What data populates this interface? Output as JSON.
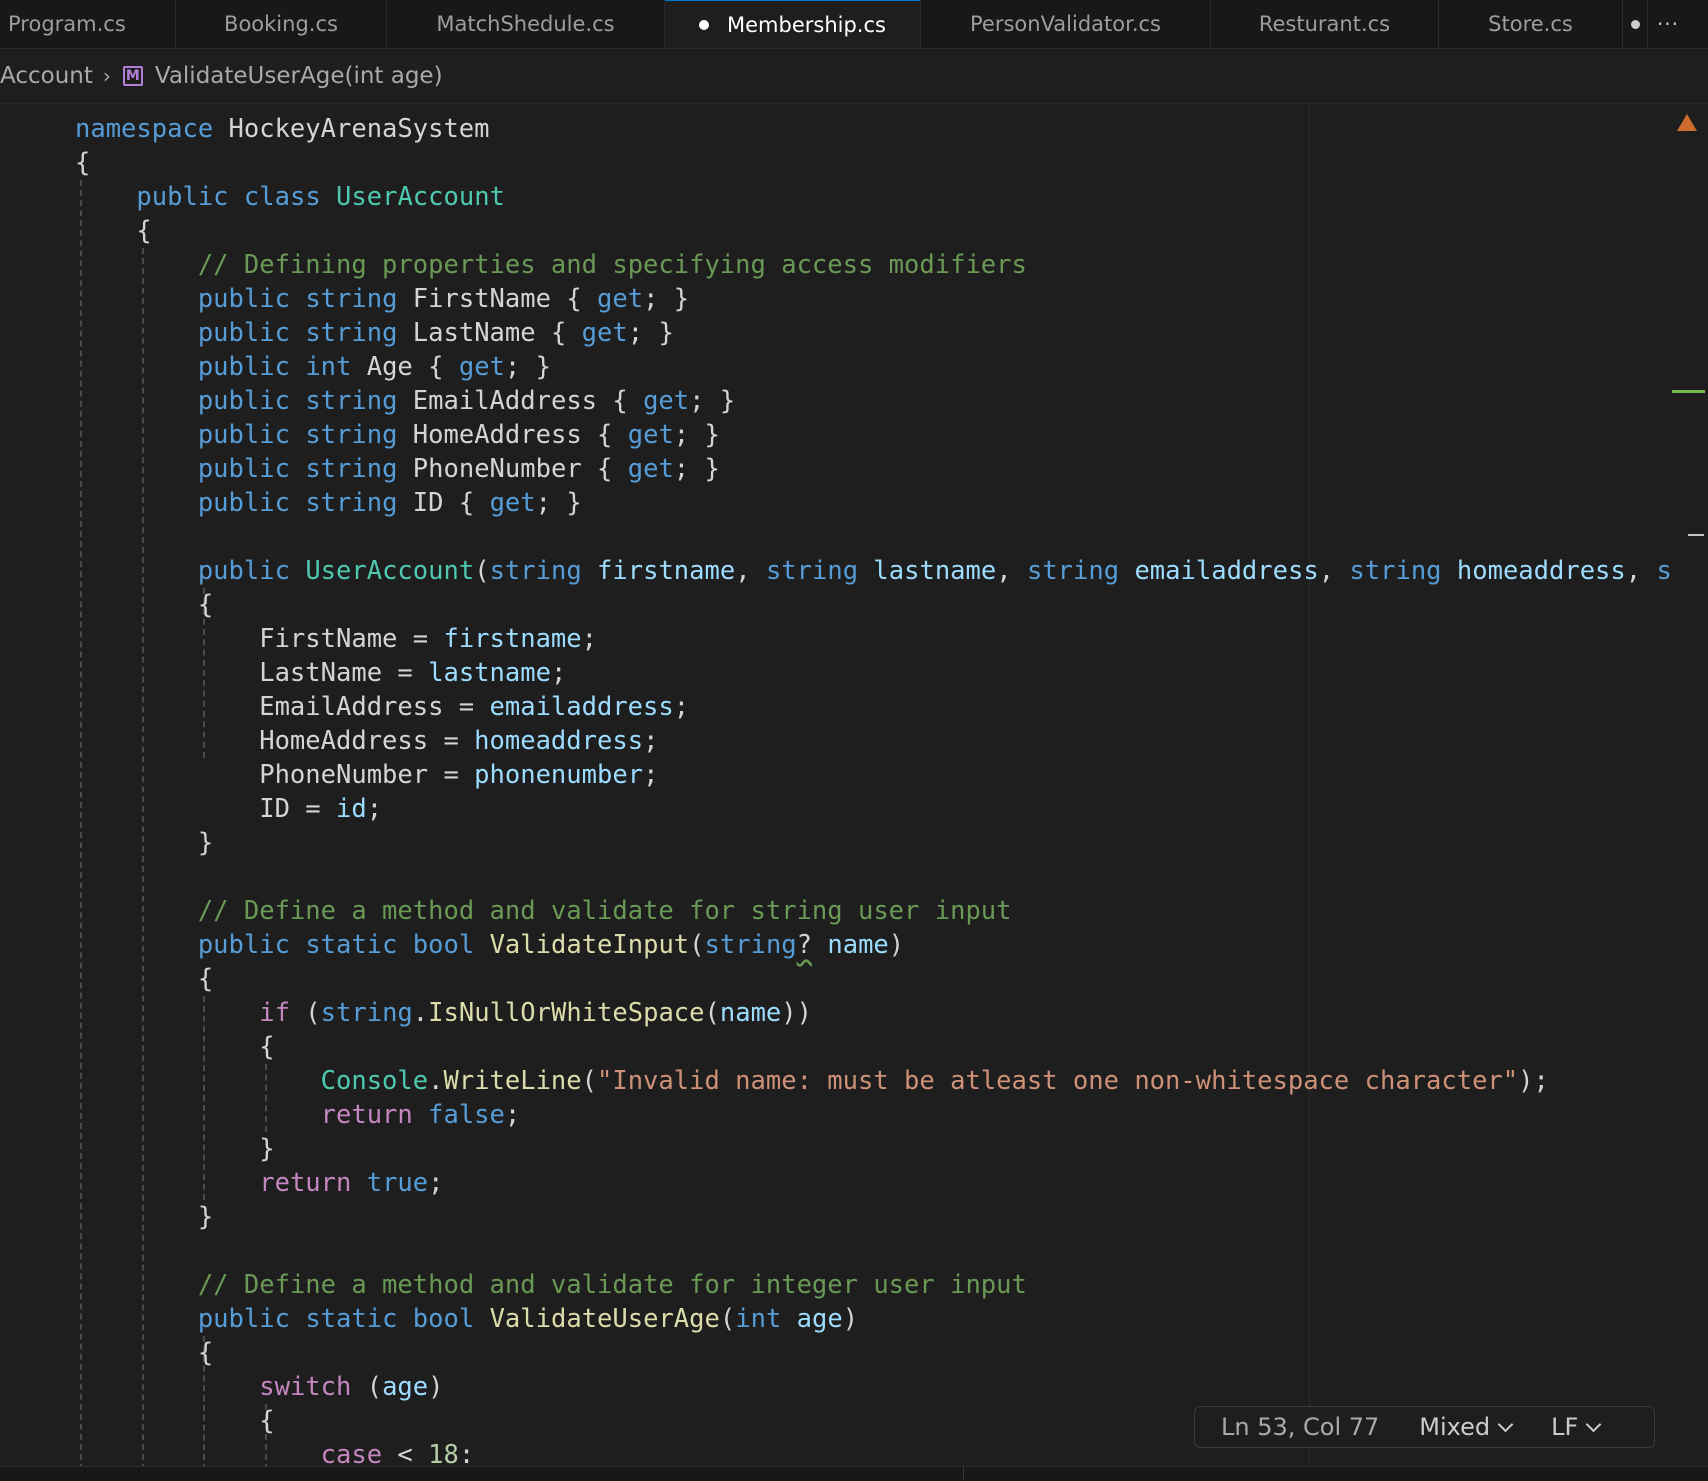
{
  "tabs": [
    {
      "label": "Program.cs",
      "active": false
    },
    {
      "label": "Booking.cs",
      "active": false
    },
    {
      "label": "MatchShedule.cs",
      "active": false
    },
    {
      "label": "Membership.cs",
      "active": true,
      "modified": true
    },
    {
      "label": "PersonValidator.cs",
      "active": false
    },
    {
      "label": "Resturant.cs",
      "active": false
    },
    {
      "label": "Store.cs",
      "active": false
    }
  ],
  "tab_more_label": "···",
  "breadcrumb": {
    "parent": "Account",
    "method": "ValidateUserAge(int age)",
    "method_icon": "method-icon"
  },
  "status": {
    "position": "Ln 53, Col 77",
    "indentation": "Mixed",
    "line_ending": "LF"
  },
  "colors": {
    "keyword": "#569cd6",
    "control": "#c586c0",
    "type": "#4ec9b0",
    "function": "#dcdcaa",
    "variable": "#9cdcfe",
    "comment": "#6a9955",
    "string": "#ce9178",
    "number": "#b5cea8",
    "warning": "#cc6d2e"
  },
  "code": {
    "lines": [
      [
        [
          "kw",
          "namespace"
        ],
        [
          "pun",
          " HockeyArenaSystem"
        ]
      ],
      [
        [
          "pun",
          "{"
        ]
      ],
      [
        [
          "pun",
          "    "
        ],
        [
          "kw",
          "public"
        ],
        [
          "pun",
          " "
        ],
        [
          "kw",
          "class"
        ],
        [
          "pun",
          " "
        ],
        [
          "typ",
          "UserAccount"
        ]
      ],
      [
        [
          "pun",
          "    {"
        ]
      ],
      [
        [
          "pun",
          "        "
        ],
        [
          "cmt",
          "// Defining properties and specifying access modifiers"
        ]
      ],
      [
        [
          "pun",
          "        "
        ],
        [
          "kw",
          "public"
        ],
        [
          "pun",
          " "
        ],
        [
          "kw",
          "string"
        ],
        [
          "pun",
          " FirstName { "
        ],
        [
          "kw",
          "get"
        ],
        [
          "pun",
          "; }"
        ]
      ],
      [
        [
          "pun",
          "        "
        ],
        [
          "kw",
          "public"
        ],
        [
          "pun",
          " "
        ],
        [
          "kw",
          "string"
        ],
        [
          "pun",
          " LastName { "
        ],
        [
          "kw",
          "get"
        ],
        [
          "pun",
          "; }"
        ]
      ],
      [
        [
          "pun",
          "        "
        ],
        [
          "kw",
          "public"
        ],
        [
          "pun",
          " "
        ],
        [
          "kw",
          "int"
        ],
        [
          "pun",
          " Age { "
        ],
        [
          "kw",
          "get"
        ],
        [
          "pun",
          "; }"
        ]
      ],
      [
        [
          "pun",
          "        "
        ],
        [
          "kw",
          "public"
        ],
        [
          "pun",
          " "
        ],
        [
          "kw",
          "string"
        ],
        [
          "pun",
          " EmailAddress { "
        ],
        [
          "kw",
          "get"
        ],
        [
          "pun",
          "; }"
        ]
      ],
      [
        [
          "pun",
          "        "
        ],
        [
          "kw",
          "public"
        ],
        [
          "pun",
          " "
        ],
        [
          "kw",
          "string"
        ],
        [
          "pun",
          " HomeAddress { "
        ],
        [
          "kw",
          "get"
        ],
        [
          "pun",
          "; }"
        ]
      ],
      [
        [
          "pun",
          "        "
        ],
        [
          "kw",
          "public"
        ],
        [
          "pun",
          " "
        ],
        [
          "kw",
          "string"
        ],
        [
          "pun",
          " PhoneNumber { "
        ],
        [
          "kw",
          "get"
        ],
        [
          "pun",
          "; }"
        ]
      ],
      [
        [
          "pun",
          "        "
        ],
        [
          "kw",
          "public"
        ],
        [
          "pun",
          " "
        ],
        [
          "kw",
          "string"
        ],
        [
          "pun",
          " ID { "
        ],
        [
          "kw",
          "get"
        ],
        [
          "pun",
          "; }"
        ]
      ],
      [],
      [
        [
          "pun",
          "        "
        ],
        [
          "kw",
          "public"
        ],
        [
          "pun",
          " "
        ],
        [
          "typ",
          "UserAccount"
        ],
        [
          "pun",
          "("
        ],
        [
          "kw",
          "string"
        ],
        [
          "pun",
          " "
        ],
        [
          "var",
          "firstname"
        ],
        [
          "pun",
          ", "
        ],
        [
          "kw",
          "string"
        ],
        [
          "pun",
          " "
        ],
        [
          "var",
          "lastname"
        ],
        [
          "pun",
          ", "
        ],
        [
          "kw",
          "string"
        ],
        [
          "pun",
          " "
        ],
        [
          "var",
          "emailaddress"
        ],
        [
          "pun",
          ", "
        ],
        [
          "kw",
          "string"
        ],
        [
          "pun",
          " "
        ],
        [
          "var",
          "homeaddress"
        ],
        [
          "pun",
          ", "
        ],
        [
          "kw",
          "s"
        ]
      ],
      [
        [
          "pun",
          "        {"
        ]
      ],
      [
        [
          "pun",
          "            FirstName = "
        ],
        [
          "var",
          "firstname"
        ],
        [
          "pun",
          ";"
        ]
      ],
      [
        [
          "pun",
          "            LastName = "
        ],
        [
          "var",
          "lastname"
        ],
        [
          "pun",
          ";"
        ]
      ],
      [
        [
          "pun",
          "            EmailAddress = "
        ],
        [
          "var",
          "emailaddress"
        ],
        [
          "pun",
          ";"
        ]
      ],
      [
        [
          "pun",
          "            HomeAddress = "
        ],
        [
          "var",
          "homeaddress"
        ],
        [
          "pun",
          ";"
        ]
      ],
      [
        [
          "pun",
          "            PhoneNumber = "
        ],
        [
          "var",
          "phonenumber"
        ],
        [
          "pun",
          ";"
        ]
      ],
      [
        [
          "pun",
          "            ID = "
        ],
        [
          "var",
          "id"
        ],
        [
          "pun",
          ";"
        ]
      ],
      [
        [
          "pun",
          "        }"
        ]
      ],
      [],
      [
        [
          "pun",
          "        "
        ],
        [
          "cmt",
          "// Define a method and validate for string user input"
        ]
      ],
      [
        [
          "pun",
          "        "
        ],
        [
          "kw",
          "public"
        ],
        [
          "pun",
          " "
        ],
        [
          "kw",
          "static"
        ],
        [
          "pun",
          " "
        ],
        [
          "kw",
          "bool"
        ],
        [
          "pun",
          " "
        ],
        [
          "fn",
          "ValidateInput"
        ],
        [
          "pun",
          "("
        ],
        [
          "kw",
          "string"
        ],
        [
          "sq",
          "?"
        ],
        [
          "pun",
          " "
        ],
        [
          "var",
          "name"
        ],
        [
          "pun",
          ")"
        ]
      ],
      [
        [
          "pun",
          "        {"
        ]
      ],
      [
        [
          "pun",
          "            "
        ],
        [
          "ctl",
          "if"
        ],
        [
          "pun",
          " ("
        ],
        [
          "kw",
          "string"
        ],
        [
          "pun",
          "."
        ],
        [
          "fn",
          "IsNullOrWhiteSpace"
        ],
        [
          "pun",
          "("
        ],
        [
          "var",
          "name"
        ],
        [
          "pun",
          "))"
        ]
      ],
      [
        [
          "pun",
          "            {"
        ]
      ],
      [
        [
          "pun",
          "                "
        ],
        [
          "typ",
          "Console"
        ],
        [
          "pun",
          "."
        ],
        [
          "fn",
          "WriteLine"
        ],
        [
          "pun",
          "("
        ],
        [
          "str",
          "\"Invalid name: must be atleast one non-whitespace character\""
        ],
        [
          "pun",
          ");"
        ]
      ],
      [
        [
          "pun",
          "                "
        ],
        [
          "ctl",
          "return"
        ],
        [
          "pun",
          " "
        ],
        [
          "kw",
          "false"
        ],
        [
          "pun",
          ";"
        ]
      ],
      [
        [
          "pun",
          "            }"
        ]
      ],
      [
        [
          "pun",
          "            "
        ],
        [
          "ctl",
          "return"
        ],
        [
          "pun",
          " "
        ],
        [
          "kw",
          "true"
        ],
        [
          "pun",
          ";"
        ]
      ],
      [
        [
          "pun",
          "        }"
        ]
      ],
      [],
      [
        [
          "pun",
          "        "
        ],
        [
          "cmt",
          "// Define a method and validate for integer user input"
        ]
      ],
      [
        [
          "pun",
          "        "
        ],
        [
          "kw",
          "public"
        ],
        [
          "pun",
          " "
        ],
        [
          "kw",
          "static"
        ],
        [
          "pun",
          " "
        ],
        [
          "kw",
          "bool"
        ],
        [
          "pun",
          " "
        ],
        [
          "fn",
          "ValidateUserAge"
        ],
        [
          "pun",
          "("
        ],
        [
          "kw",
          "int"
        ],
        [
          "pun",
          " "
        ],
        [
          "var",
          "age"
        ],
        [
          "pun",
          ")"
        ]
      ],
      [
        [
          "pun",
          "        {"
        ]
      ],
      [
        [
          "pun",
          "            "
        ],
        [
          "ctl",
          "switch"
        ],
        [
          "pun",
          " ("
        ],
        [
          "var",
          "age"
        ],
        [
          "pun",
          ")"
        ]
      ],
      [
        [
          "pun",
          "            {"
        ]
      ],
      [
        [
          "pun",
          "                "
        ],
        [
          "ctl",
          "case"
        ],
        [
          "pun",
          " < "
        ],
        [
          "num",
          "18"
        ],
        [
          "pun",
          ":"
        ]
      ]
    ]
  }
}
